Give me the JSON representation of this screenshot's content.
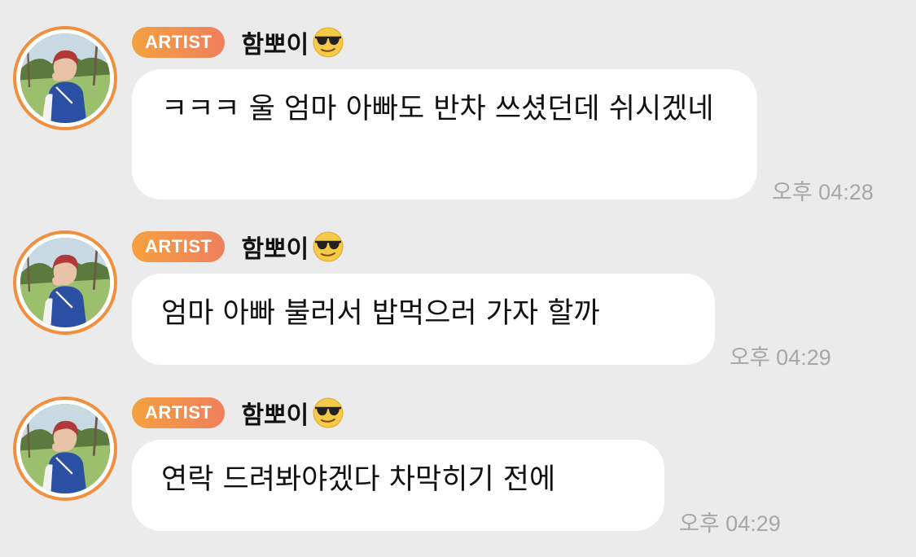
{
  "badge_label": "ARTIST",
  "colors": {
    "background": "#ebebeb",
    "bubble": "#ffffff",
    "badge_gradient_start": "#f5a140",
    "badge_gradient_end": "#ef7f5d",
    "avatar_ring": "#f08f3e",
    "timestamp": "#a7a7a7"
  },
  "messages": [
    {
      "sender": "함뽀이",
      "sender_emoji": "smiling-face-with-sunglasses-icon",
      "text": "ㅋㅋㅋ 울 엄마 아빠도 반차 쓰셨던데 쉬시겠네",
      "time": "오후 04:28"
    },
    {
      "sender": "함뽀이",
      "sender_emoji": "smiling-face-with-sunglasses-icon",
      "text": "엄마 아빠 불러서 밥먹으러 가자 할까",
      "time": "오후 04:29"
    },
    {
      "sender": "함뽀이",
      "sender_emoji": "smiling-face-with-sunglasses-icon",
      "text": "연락 드려봐야겠다 차막히기 전에",
      "time": "오후 04:29"
    }
  ]
}
